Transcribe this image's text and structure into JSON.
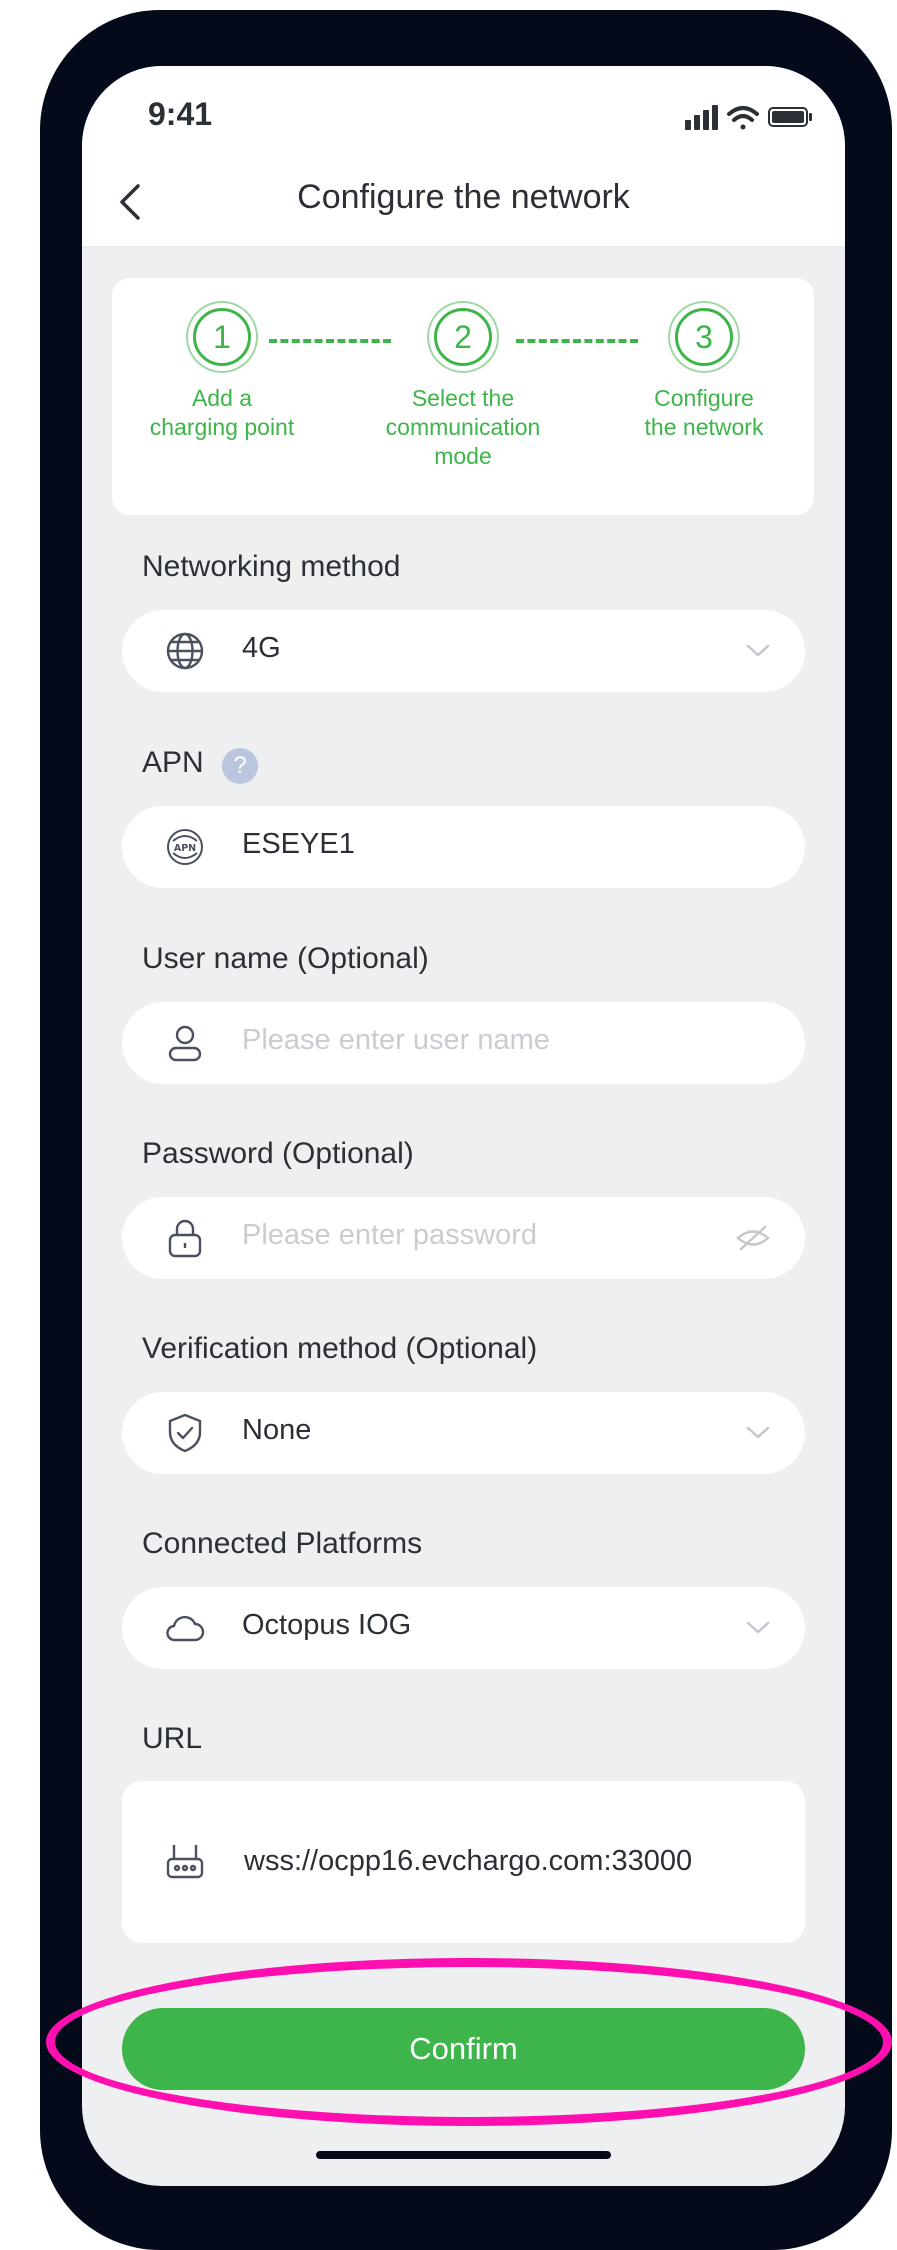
{
  "status_bar": {
    "time": "9:41"
  },
  "header": {
    "title": "Configure the network"
  },
  "stepper": {
    "steps": [
      {
        "number": "1",
        "label_line1": "Add a",
        "label_line2": "charging point",
        "label_line3": ""
      },
      {
        "number": "2",
        "label_line1": "Select the",
        "label_line2": "communication",
        "label_line3": "mode"
      },
      {
        "number": "3",
        "label_line1": "Configure",
        "label_line2": "the network",
        "label_line3": ""
      }
    ]
  },
  "form": {
    "networking": {
      "label": "Networking method",
      "value": "4G"
    },
    "apn": {
      "label": "APN",
      "help": "?",
      "value": "ESEYE1"
    },
    "username": {
      "label": "User name (Optional)",
      "placeholder": "Please enter user name"
    },
    "password": {
      "label": "Password (Optional)",
      "placeholder": "Please enter password"
    },
    "verification": {
      "label": "Verification method (Optional)",
      "value": "None"
    },
    "platforms": {
      "label": "Connected Platforms",
      "value": "Octopus IOG"
    },
    "url": {
      "label": "URL",
      "value": "wss://ocpp16.evchargo.com:33000"
    }
  },
  "actions": {
    "confirm_label": "Confirm"
  },
  "colors": {
    "accent": "#3db54a",
    "highlight": "#ff0fb0",
    "frame": "#050a1a"
  }
}
